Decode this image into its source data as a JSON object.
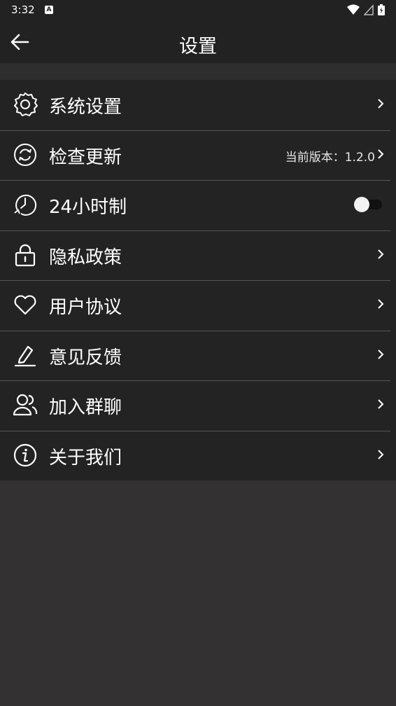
{
  "status_bar": {
    "time": "3:32",
    "notification_badge": "A"
  },
  "header": {
    "title": "设置"
  },
  "settings": {
    "items": [
      {
        "label": "系统设置",
        "icon": "gear-icon"
      },
      {
        "label": "检查更新",
        "icon": "refresh-icon",
        "value": "当前版本：1.2.0"
      },
      {
        "label": "24小时制",
        "icon": "clock-icon",
        "toggle_on": false
      },
      {
        "label": "隐私政策",
        "icon": "lock-icon"
      },
      {
        "label": "用户协议",
        "icon": "heart-icon"
      },
      {
        "label": "意见反馈",
        "icon": "edit-icon"
      },
      {
        "label": "加入群聊",
        "icon": "users-icon"
      },
      {
        "label": "关于我们",
        "icon": "info-icon"
      }
    ]
  },
  "colors": {
    "background": "#333132",
    "header": "#222222",
    "list_background": "#232323",
    "divider": "#555555"
  }
}
